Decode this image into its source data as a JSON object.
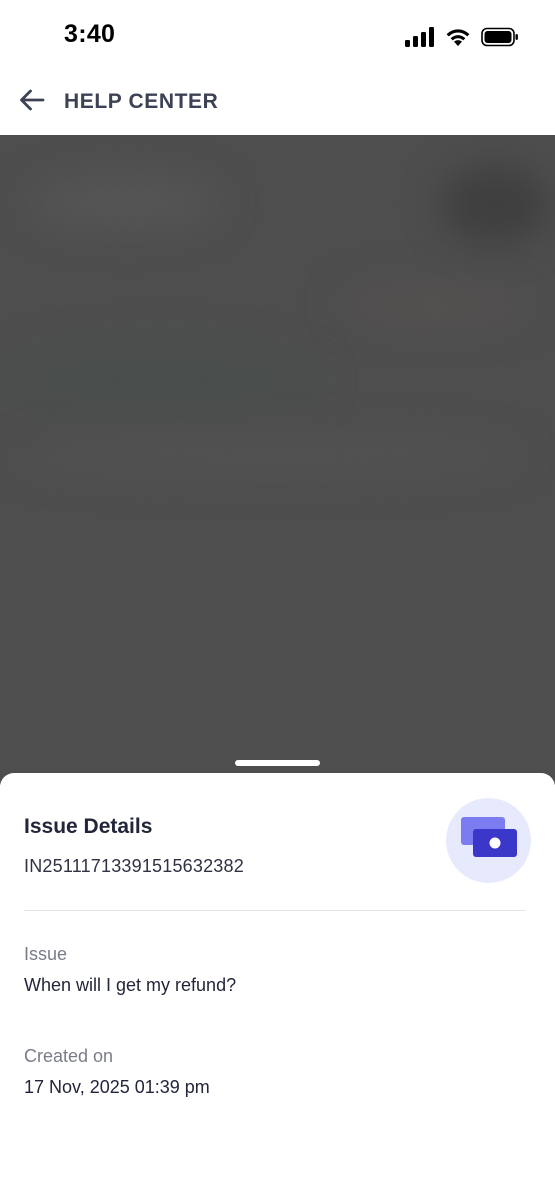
{
  "status_bar": {
    "time": "3:40",
    "icons": [
      "signal-icon",
      "wifi-icon",
      "battery-icon"
    ]
  },
  "header": {
    "back_icon": "arrow-left-icon",
    "title": "HELP CENTER"
  },
  "issue_details": {
    "title": "Issue Details",
    "id": "IN25111713391515632382",
    "badge_icon": "refund-cash-icon",
    "issue_label": "Issue",
    "issue_value": "When will I get my refund?",
    "created_label": "Created on",
    "created_value": "17 Nov, 2025 01:39 pm"
  },
  "colors": {
    "accent": "#3a37c9",
    "accent_light": "#7b7cf0",
    "badge_bg": "#e7eafc",
    "overlay": "#4e4e4e"
  }
}
